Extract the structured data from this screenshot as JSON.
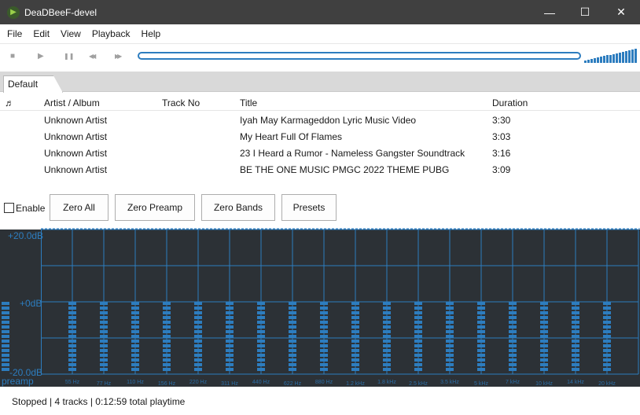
{
  "window": {
    "title": "DeaDBeeF-devel",
    "minimize": "—",
    "maximize": "☐",
    "close": "✕"
  },
  "menu": [
    "File",
    "Edit",
    "View",
    "Playback",
    "Help"
  ],
  "toolbar": {
    "icons": [
      "stop-icon",
      "play-icon",
      "pause-icon",
      "prev-icon",
      "next-icon"
    ],
    "glyphs": [
      "■",
      "▶",
      "❚❚",
      "◀◀",
      "▶▶"
    ],
    "seek_progress": 0,
    "volume_percent": 100
  },
  "tabs": [
    {
      "label": "Default"
    }
  ],
  "playlist": {
    "columns": [
      "♬",
      "Artist / Album",
      "Track No",
      "Title",
      "Duration"
    ],
    "rows": [
      {
        "artist": "Unknown Artist",
        "track": "",
        "title": "Iyah May Karmageddon Lyric Music Video",
        "duration": "3:30"
      },
      {
        "artist": "Unknown Artist",
        "track": "",
        "title": "My Heart Full Of Flames",
        "duration": "3:03"
      },
      {
        "artist": "Unknown Artist",
        "track": "",
        "title": "23 I Heard a Rumor - Nameless Gangster Soundtrack",
        "duration": "3:16"
      },
      {
        "artist": "Unknown Artist",
        "track": "",
        "title": "BE THE ONE MUSIC PMGC 2022 THEME PUBG",
        "duration": "3:09"
      }
    ]
  },
  "eq": {
    "enable_label": "Enable",
    "enabled": false,
    "buttons": [
      "Zero All",
      "Zero Preamp",
      "Zero Bands",
      "Presets"
    ],
    "max_label": "+20.0dB",
    "mid_label": "+0dB",
    "min_label": "-20.0dB",
    "preamp_label": "preamp",
    "preamp_db": 0,
    "bands": [
      "55 Hz",
      "77 Hz",
      "110 Hz",
      "156 Hz",
      "220 Hz",
      "311 Hz",
      "440 Hz",
      "622 Hz",
      "880 Hz",
      "1.2 kHz",
      "1.8 kHz",
      "2.5 kHz",
      "3.5 kHz",
      "5 kHz",
      "7 kHz",
      "10 kHz",
      "14 kHz",
      "20 kHz"
    ],
    "band_db": [
      0,
      0,
      0,
      0,
      0,
      0,
      0,
      0,
      0,
      0,
      0,
      0,
      0,
      0,
      0,
      0,
      0,
      0
    ],
    "accent": "#2d7dbf"
  },
  "status": "Stopped | 4 tracks | 0:12:59 total playtime"
}
